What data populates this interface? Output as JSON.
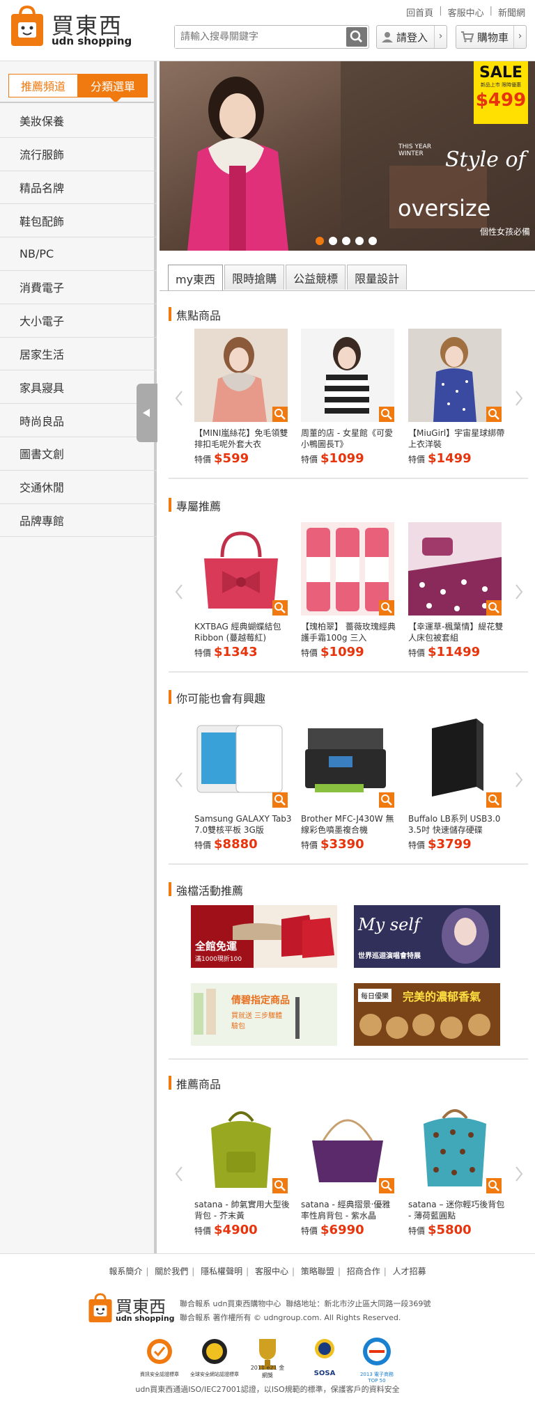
{
  "header": {
    "logo_cn": "買東西",
    "logo_en": "udn shopping",
    "links": [
      "回首頁",
      "客服中心",
      "新聞網"
    ],
    "search_placeholder": "請輸入搜尋關鍵字",
    "login_label": "請登入",
    "cart_label": "購物車"
  },
  "sidebar": {
    "tab_recommend": "推薦頻道",
    "tab_category": "分類選單",
    "items": [
      "美妝保養",
      "流行服飾",
      "精品名牌",
      "鞋包配飾",
      "NB/PC",
      "消費電子",
      "大小電子",
      "居家生活",
      "家具寢具",
      "時尚良品",
      "圖書文創",
      "交通休閒",
      "品牌專館"
    ]
  },
  "banner": {
    "sale_word": "SALE",
    "sale_sub": "新品上市 限時優惠",
    "sale_price": "$499",
    "this_year": "THIS YEAR WINTER",
    "style_of": "Style of",
    "oversize": "oversize",
    "tagline": "個性女孩必備"
  },
  "main_tabs": [
    "my東西",
    "限時搶購",
    "公益競標",
    "限量設計"
  ],
  "sections": {
    "focus": {
      "title": "焦點商品",
      "products": [
        {
          "name": "【MINI嵐絲花】免毛領雙排扣毛呢外套大衣",
          "price": "$599"
        },
        {
          "name": "周董的店 - 女星館《可愛小鴨圖長T》",
          "price": "$1099"
        },
        {
          "name": "【MiuGirl】宇宙星球綁帶上衣洋裝",
          "price": "$1499"
        }
      ]
    },
    "exclusive": {
      "title": "專屬推薦",
      "products": [
        {
          "name": "KXTBAG 經典蝴蝶結包 Ribbon (蔓越莓紅)",
          "price": "$1343"
        },
        {
          "name": "【瑰柏翠】 薔薇玫瑰經典護手霜100g 三入",
          "price": "$1099"
        },
        {
          "name": "【幸運草-楓葉情】緹花雙人床包被套組",
          "price": "$11499"
        }
      ]
    },
    "interest": {
      "title": "你可能也會有興趣",
      "products": [
        {
          "name": "Samsung GALAXY Tab3 7.0雙核平板 3G版",
          "price": "$8880"
        },
        {
          "name": "Brother MFC-J430W 無線彩色噴墨複合機",
          "price": "$3390"
        },
        {
          "name": "Buffalo LB系列 USB3.0 3.5吋 快速儲存硬碟",
          "price": "$3799"
        }
      ]
    },
    "campaign": {
      "title": "強檔活動推薦",
      "promos": [
        {
          "text1": "全館免運",
          "text2": "滿1000現折100"
        },
        {
          "text1": "My self",
          "text2": "世界巡迴演唱會特展"
        },
        {
          "text1": "倩碧指定商品",
          "text2": "買就送 三步驟體驗包"
        },
        {
          "text1": "每日優樂",
          "text2": "完美的濃郁香氣"
        }
      ]
    },
    "recommend": {
      "title": "推薦商品",
      "products": [
        {
          "name": "satana - 帥氣實用大型後背包 - 芥末黃",
          "price": "$4900"
        },
        {
          "name": "satana - 經典摺景‧優雅率性肩背包 - 紫水晶",
          "price": "$6990"
        },
        {
          "name": "satana – 迷你輕巧後背包 - 薄荷藍圓點",
          "price": "$5800"
        }
      ]
    }
  },
  "price_label": "特價",
  "footer": {
    "links": [
      "報系簡介",
      "關於我們",
      "隱私權聲明",
      "客服中心",
      "策略聯盟",
      "招商合作",
      "人才招募"
    ],
    "company": "聯合報系 udn買東西購物中心",
    "address": "聯絡地址：新北市汐止區大同路一段369號",
    "copyright": "聯合報系 著作權所有 © udngroup.com. All Rights Reserved.",
    "cert": "udn買東西通過ISO/IEC27001認證，以ISO規範的標準，保護客戶的資料安全",
    "badge_labels": [
      "資訊安全認證標章",
      "全球安全網站認證標章",
      "2011 e21 金網獎",
      "SOSA",
      "2013 電子商務 TOP 50"
    ]
  },
  "colors": {
    "accent": "#f07a10",
    "price": "#e8340c"
  }
}
